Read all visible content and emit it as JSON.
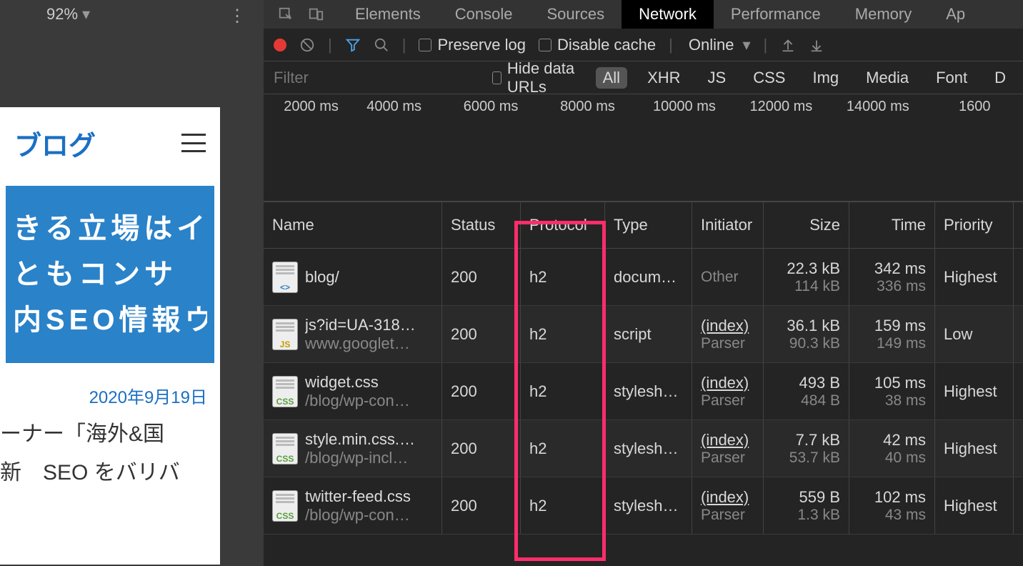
{
  "zoom": "92%",
  "mobile": {
    "logo": "ブログ",
    "hero_lines": [
      "きる立場はイ",
      "ともコンサ",
      "内SEO情報ウ"
    ],
    "date": "2020年9月19日",
    "body_lines": [
      "ーナー「海外&国",
      "新　SEO をバリバ"
    ]
  },
  "devtools": {
    "tabs": [
      "Elements",
      "Console",
      "Sources",
      "Network",
      "Performance",
      "Memory",
      "Ap"
    ],
    "active_tab": "Network",
    "preserve_log": "Preserve log",
    "disable_cache": "Disable cache",
    "throttle": "Online",
    "filter_placeholder": "Filter",
    "hide_data_urls": "Hide data URLs",
    "type_filters": [
      "All",
      "XHR",
      "JS",
      "CSS",
      "Img",
      "Media",
      "Font",
      "D"
    ],
    "timeline_ticks": [
      "2000 ms",
      "4000 ms",
      "6000 ms",
      "8000 ms",
      "10000 ms",
      "12000 ms",
      "14000 ms",
      "1600"
    ],
    "columns": [
      "Name",
      "Status",
      "Protocol",
      "Type",
      "Initiator",
      "Size",
      "Time",
      "Priority"
    ],
    "rows": [
      {
        "icon": "html",
        "icon_label": "<>",
        "name": "blog/",
        "sub": "",
        "status": "200",
        "protocol": "h2",
        "type": "docum…",
        "initiator": "Other",
        "initiator_sub": "",
        "size": "22.3 kB",
        "size_sub": "114 kB",
        "time": "342 ms",
        "time_sub": "336 ms",
        "priority": "Highest"
      },
      {
        "icon": "js",
        "icon_label": "JS",
        "name": "js?id=UA-318…",
        "sub": "www.googlet…",
        "status": "200",
        "protocol": "h2",
        "type": "script",
        "initiator": "(index)",
        "initiator_sub": "Parser",
        "size": "36.1 kB",
        "size_sub": "90.3 kB",
        "time": "159 ms",
        "time_sub": "149 ms",
        "priority": "Low"
      },
      {
        "icon": "css",
        "icon_label": "CSS",
        "name": "widget.css",
        "sub": "/blog/wp-con…",
        "status": "200",
        "protocol": "h2",
        "type": "stylesh…",
        "initiator": "(index)",
        "initiator_sub": "Parser",
        "size": "493 B",
        "size_sub": "484 B",
        "time": "105 ms",
        "time_sub": "38 ms",
        "priority": "Highest"
      },
      {
        "icon": "css",
        "icon_label": "CSS",
        "name": "style.min.css.…",
        "sub": "/blog/wp-incl…",
        "status": "200",
        "protocol": "h2",
        "type": "stylesh…",
        "initiator": "(index)",
        "initiator_sub": "Parser",
        "size": "7.7 kB",
        "size_sub": "53.7 kB",
        "time": "42 ms",
        "time_sub": "40 ms",
        "priority": "Highest"
      },
      {
        "icon": "css",
        "icon_label": "CSS",
        "name": "twitter-feed.css",
        "sub": "/blog/wp-con…",
        "status": "200",
        "protocol": "h2",
        "type": "stylesh…",
        "initiator": "(index)",
        "initiator_sub": "Parser",
        "size": "559 B",
        "size_sub": "1.3 kB",
        "time": "102 ms",
        "time_sub": "43 ms",
        "priority": "Highest"
      }
    ]
  }
}
